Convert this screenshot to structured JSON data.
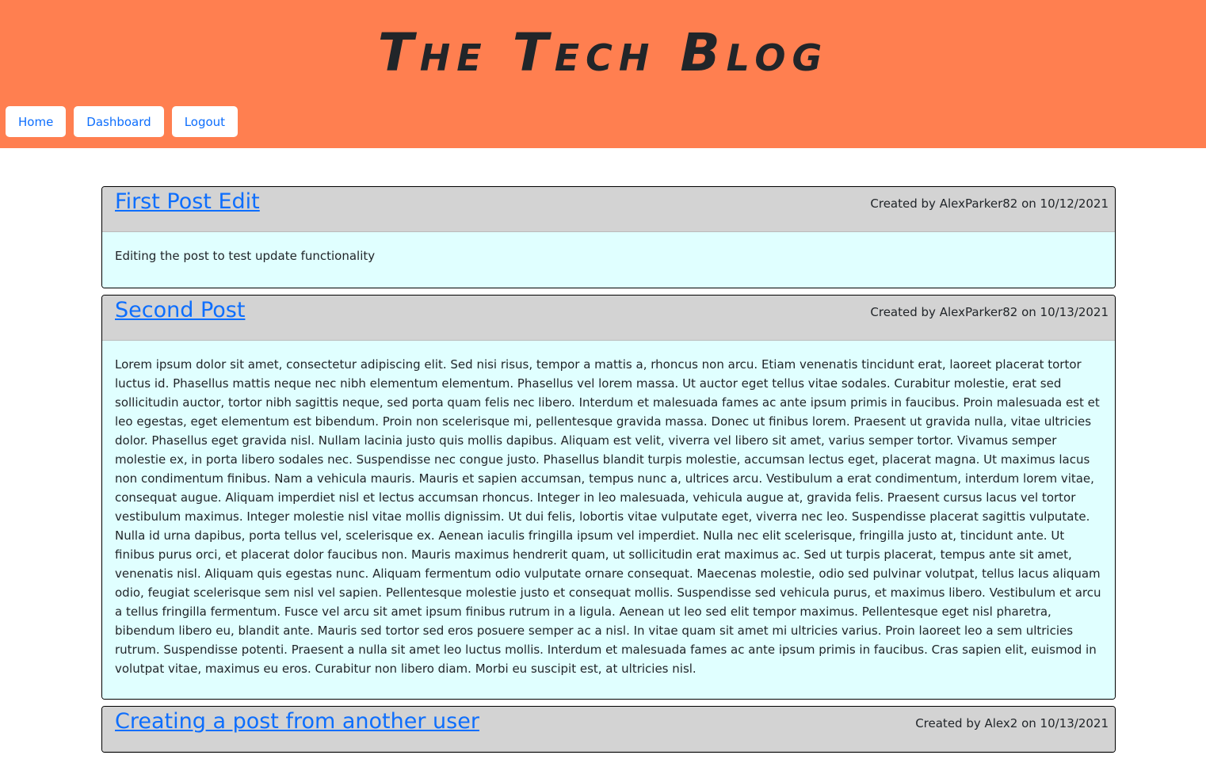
{
  "header": {
    "logo_text": "The Tech Blog",
    "bg_color": "#ff7f50"
  },
  "nav": {
    "items": [
      {
        "label": "Home"
      },
      {
        "label": "Dashboard"
      },
      {
        "label": "Logout"
      }
    ]
  },
  "posts": [
    {
      "title": "First Post Edit",
      "meta": "Created by AlexParker82 on 10/12/2021",
      "body": "Editing the post to test update functionality"
    },
    {
      "title": "Second Post",
      "meta": "Created by AlexParker82 on 10/13/2021",
      "body": "Lorem ipsum dolor sit amet, consectetur adipiscing elit. Sed nisi risus, tempor a mattis a, rhoncus non arcu. Etiam venenatis tincidunt erat, laoreet placerat tortor luctus id. Phasellus mattis neque nec nibh elementum elementum. Phasellus vel lorem massa. Ut auctor eget tellus vitae sodales. Curabitur molestie, erat sed sollicitudin auctor, tortor nibh sagittis neque, sed porta quam felis nec libero. Interdum et malesuada fames ac ante ipsum primis in faucibus. Proin malesuada est et leo egestas, eget elementum est bibendum. Proin non scelerisque mi, pellentesque gravida massa. Donec ut finibus lorem. Praesent ut gravida nulla, vitae ultricies dolor. Phasellus eget gravida nisl. Nullam lacinia justo quis mollis dapibus. Aliquam est velit, viverra vel libero sit amet, varius semper tortor. Vivamus semper molestie ex, in porta libero sodales nec. Suspendisse nec congue justo. Phasellus blandit turpis molestie, accumsan lectus eget, placerat magna. Ut maximus lacus non condimentum finibus. Nam a vehicula mauris. Mauris et sapien accumsan, tempus nunc a, ultrices arcu. Vestibulum a erat condimentum, interdum lorem vitae, consequat augue. Aliquam imperdiet nisl et lectus accumsan rhoncus. Integer in leo malesuada, vehicula augue at, gravida felis. Praesent cursus lacus vel tortor vestibulum maximus. Integer molestie nisl vitae mollis dignissim. Ut dui felis, lobortis vitae vulputate eget, viverra nec leo. Suspendisse placerat sagittis vulputate. Nulla id urna dapibus, porta tellus vel, scelerisque ex. Aenean iaculis fringilla ipsum vel imperdiet. Nulla nec elit scelerisque, fringilla justo at, tincidunt ante. Ut finibus purus orci, et placerat dolor faucibus non. Mauris maximus hendrerit quam, ut sollicitudin erat maximus ac. Sed ut turpis placerat, tempus ante sit amet, venenatis nisl. Aliquam quis egestas nunc. Aliquam fermentum odio vulputate ornare consequat. Maecenas molestie, odio sed pulvinar volutpat, tellus lacus aliquam odio, feugiat scelerisque sem nisl vel sapien. Pellentesque molestie justo et consequat mollis. Suspendisse sed vehicula purus, et maximus libero. Vestibulum et arcu a tellus fringilla fermentum. Fusce vel arcu sit amet ipsum finibus rutrum in a ligula. Aenean ut leo sed elit tempor maximus. Pellentesque eget nisl pharetra, bibendum libero eu, blandit ante. Mauris sed tortor sed eros posuere semper ac a nisl. In vitae quam sit amet mi ultricies varius. Proin laoreet leo a sem ultricies rutrum. Suspendisse potenti. Praesent a nulla sit amet leo luctus mollis. Interdum et malesuada fames ac ante ipsum primis in faucibus. Cras sapien elit, euismod in volutpat vitae, maximus eu eros. Curabitur non libero diam. Morbi eu suscipit est, at ultricies nisl."
    },
    {
      "title": "Creating a post from another user",
      "meta": "Created by Alex2 on 10/13/2021",
      "body": ""
    }
  ],
  "colors": {
    "header_bg": "#ff7f50",
    "card_head_bg": "#d3d3d3",
    "card_body_bg": "#e0ffff",
    "link": "#0d6efd"
  }
}
